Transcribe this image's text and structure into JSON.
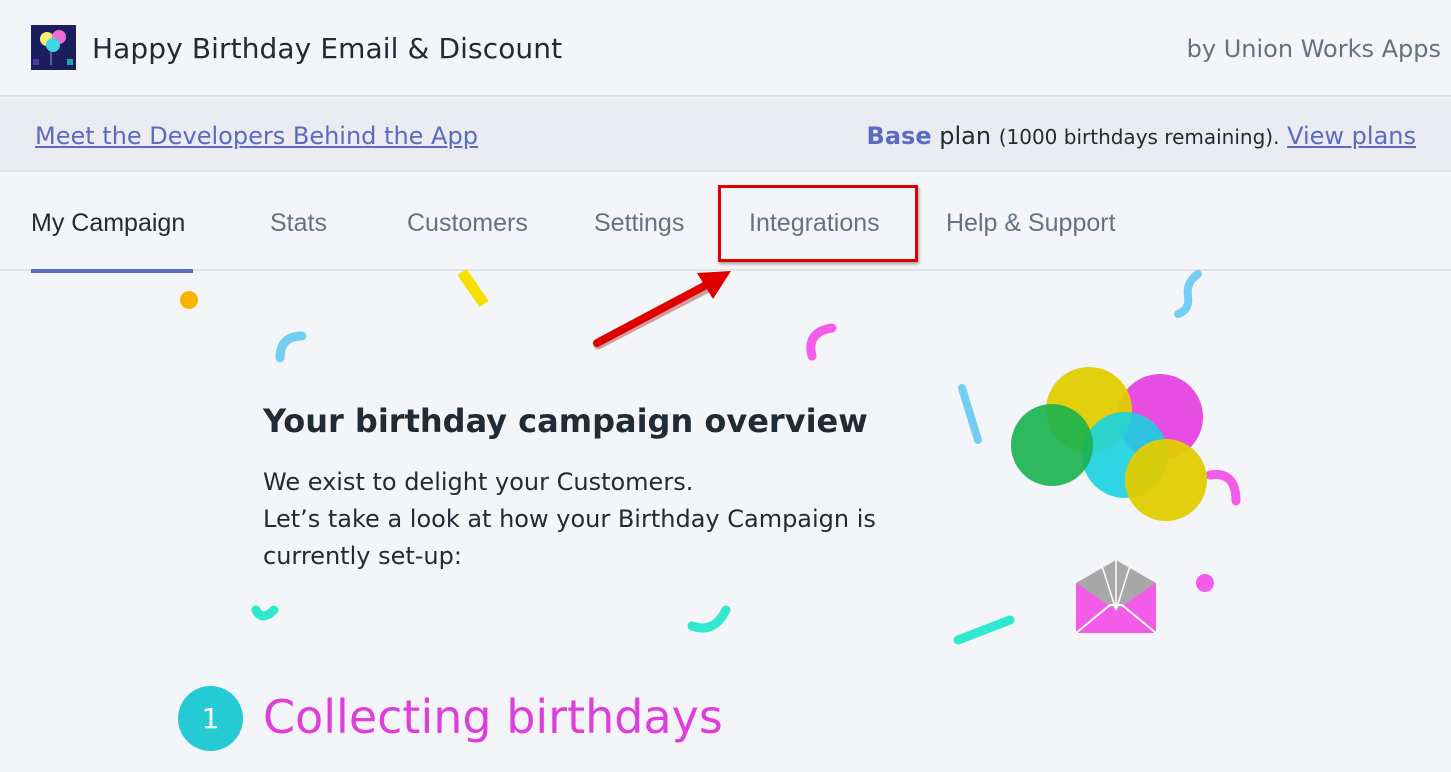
{
  "app": {
    "title": "Happy Birthday Email & Discount",
    "vendor": "by Union Works Apps"
  },
  "banner": {
    "link_label": "Meet the Developers Behind the App",
    "plan_name": "Base",
    "plan_word": " plan ",
    "plan_remaining": "(1000 birthdays remaining).",
    "plan_link": "View plans"
  },
  "tabs": [
    {
      "label": "My Campaign",
      "active": true
    },
    {
      "label": "Stats"
    },
    {
      "label": "Customers"
    },
    {
      "label": "Settings"
    },
    {
      "label": "Integrations",
      "highlighted": true
    },
    {
      "label": "Help & Support"
    }
  ],
  "hero": {
    "title": "Your birthday campaign overview",
    "line1": "We exist to delight your Customers.",
    "line2": "Let’s take a look at how your Birthday Campaign is currently set-up:"
  },
  "section": {
    "number": "1",
    "title": "Collecting birthdays"
  },
  "colors": {
    "accent": "#5c6ac4",
    "section_title": "#de3fdc",
    "badge": "#24cbd4",
    "highlight": "#e00000"
  },
  "icons": [
    "app-logo-balloons",
    "red-arrow",
    "balloons-illustration",
    "envelope-illustration"
  ]
}
